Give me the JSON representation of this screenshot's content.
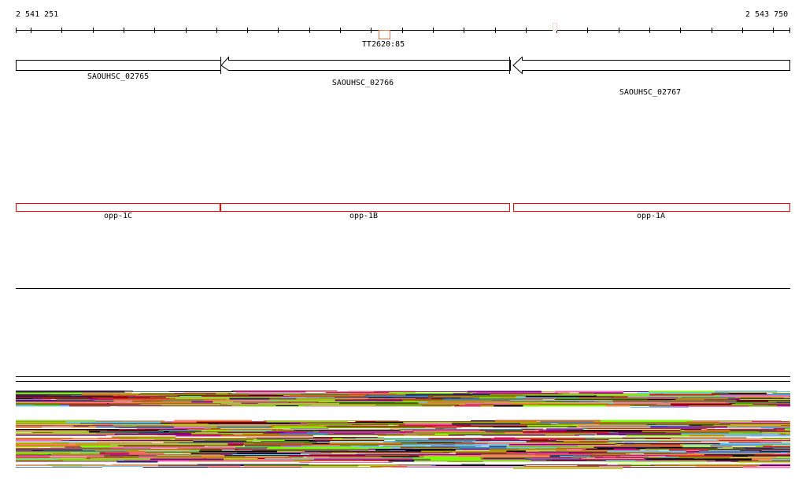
{
  "ruler": {
    "start": "2 541 251",
    "end": "2 543 750"
  },
  "markers": [
    {
      "label": "TT2620:85",
      "color": "#f07050"
    }
  ],
  "genes": [
    {
      "id": "SAOUHSC_02765",
      "strand": "-"
    },
    {
      "id": "SAOUHSC_02766",
      "strand": "-"
    },
    {
      "id": "SAOUHSC_02767",
      "strand": "-"
    }
  ],
  "operon_features": [
    {
      "label": "opp-1C",
      "color": "#ff0000"
    },
    {
      "label": "opp-1B",
      "color": "#ff0000"
    },
    {
      "label": "opp-1A",
      "color": "#ff0000"
    }
  ],
  "read_palette": [
    "#000000",
    "#6b8e00",
    "#d2691e",
    "#ff7f50",
    "#c71585",
    "#8b0000",
    "#9acd32",
    "#66ccff",
    "#ff69b4",
    "#808000",
    "#1e1e5a",
    "#b8860b",
    "#dc143c",
    "#7cfc00",
    "#a0522d",
    "#4682b4",
    "#d8a070",
    "#800080",
    "#aaaa00",
    "#795548"
  ]
}
